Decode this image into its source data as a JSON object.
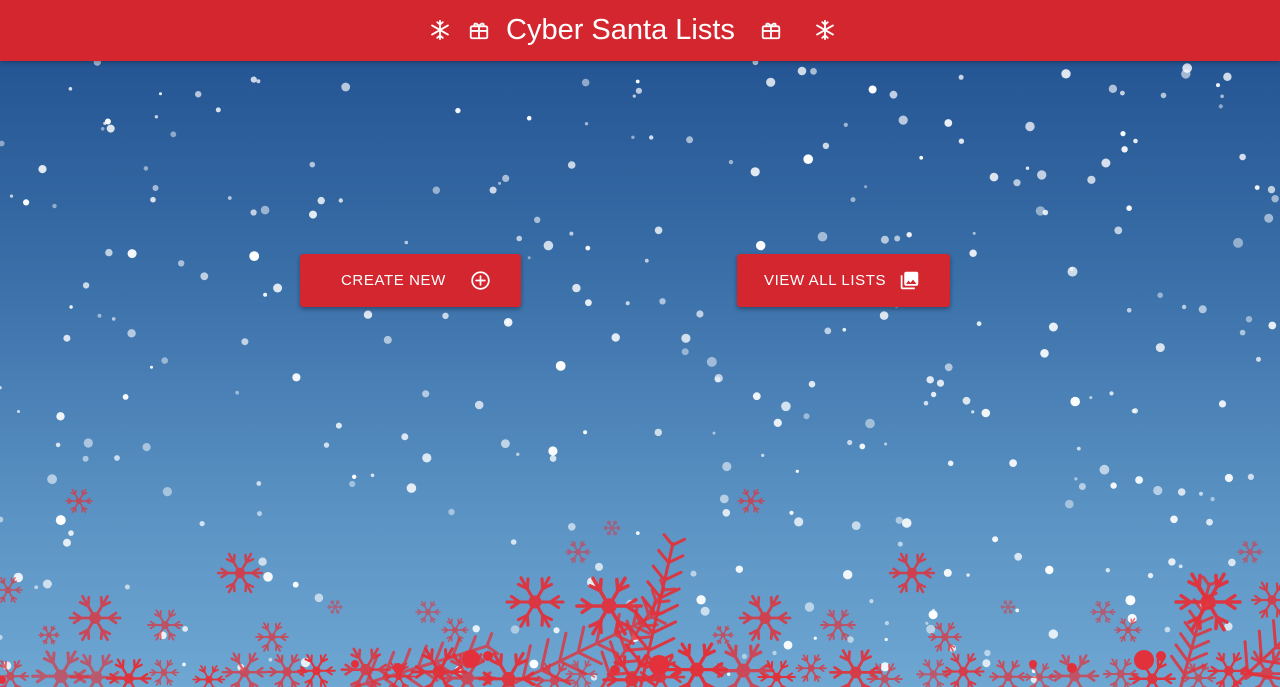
{
  "header": {
    "title": "Cyber Santa Lists",
    "icons": [
      "snowflake-icon",
      "gift-icon",
      "gift-icon",
      "snowflake-icon"
    ]
  },
  "actions": {
    "create_new": {
      "label": "CREATE NEW",
      "icon": "add-circle-icon"
    },
    "view_all": {
      "label": "VIEW ALL LISTS",
      "icon": "photo-library-icon"
    }
  },
  "colors": {
    "brand_red": "#d3262e",
    "sky_top": "#1f4e8e",
    "sky_bottom": "#6ea7d2",
    "snow": "#ffffff",
    "decor_red": "#e2313a"
  }
}
